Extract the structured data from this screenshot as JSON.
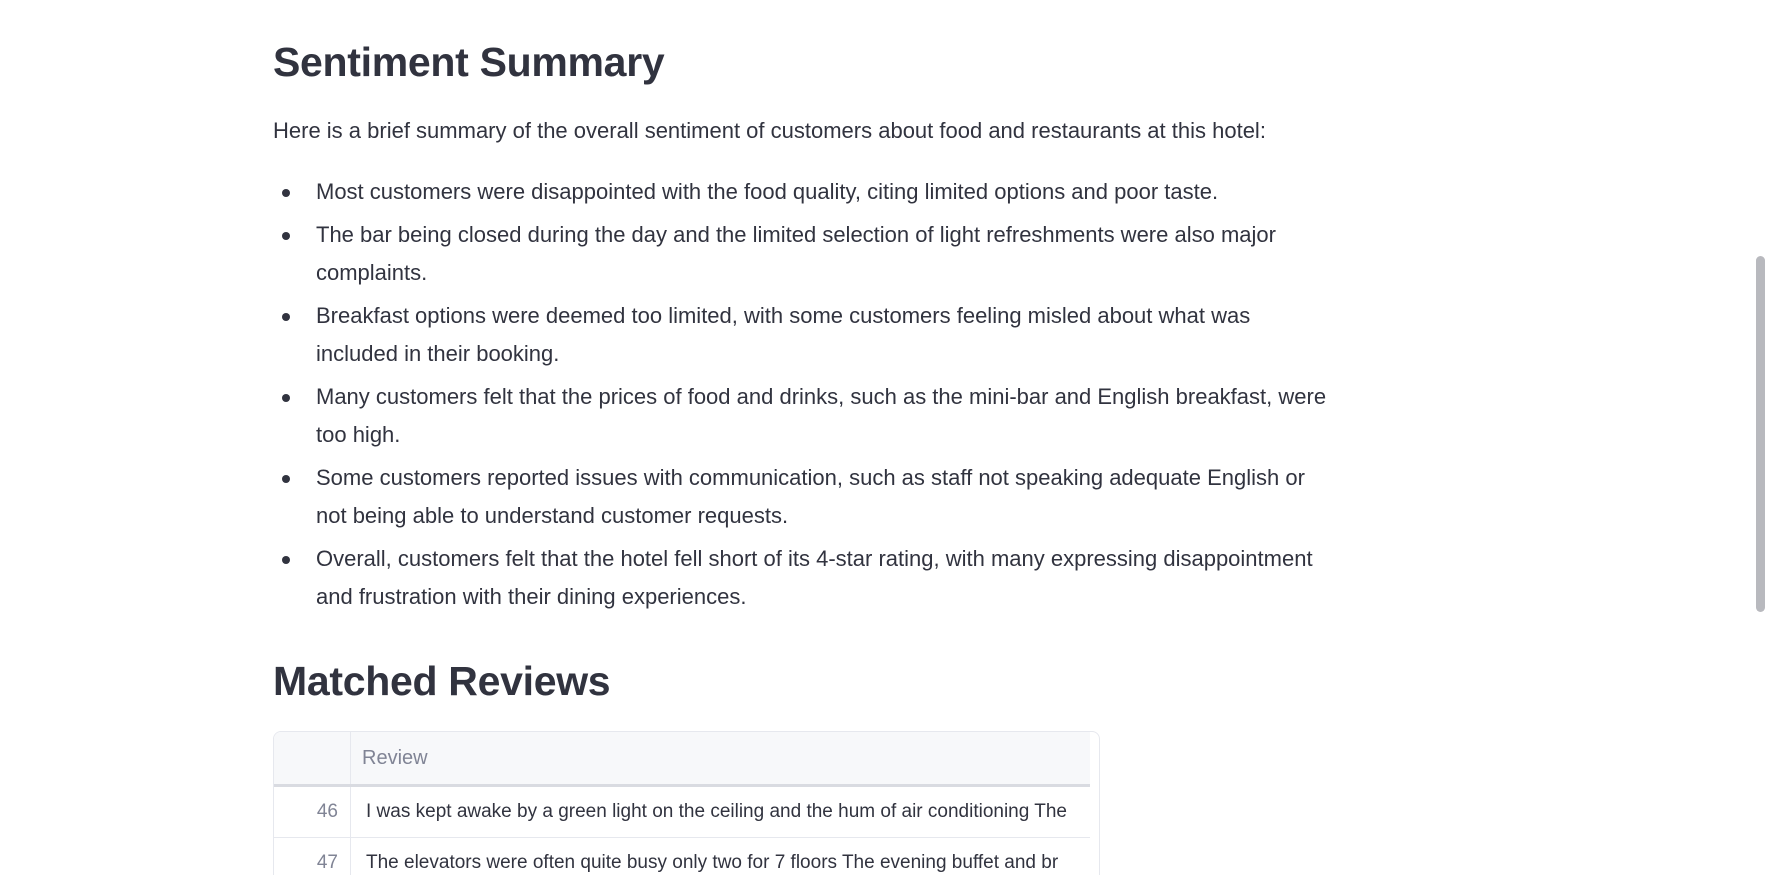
{
  "summary": {
    "title": "Sentiment Summary",
    "intro": "Here is a brief summary of the overall sentiment of customers about food and restaurants at this hotel:",
    "bullets": [
      "Most customers were disappointed with the food quality, citing limited options and poor taste.",
      "The bar being closed during the day and the limited selection of light refreshments were also major complaints.",
      "Breakfast options were deemed too limited, with some customers feeling misled about what was included in their booking.",
      "Many customers felt that the prices of food and drinks, such as the mini-bar and English breakfast, were too high.",
      "Some customers reported issues with communication, such as staff not speaking adequate English or not being able to understand customer requests.",
      "Overall, customers felt that the hotel fell short of its 4-star rating, with many expressing disappointment and frustration with their dining experiences."
    ]
  },
  "reviews": {
    "title": "Matched Reviews",
    "table": {
      "columns": [
        "",
        "Review"
      ],
      "rows": [
        {
          "index": "46",
          "review": "I was kept awake by a green light on the ceiling and the hum of air conditioning The"
        },
        {
          "index": "47",
          "review": "The elevators were often quite busy only two for 7 floors  The evening buffet and br"
        }
      ]
    }
  }
}
